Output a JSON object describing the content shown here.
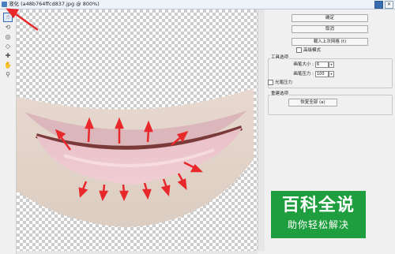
{
  "window": {
    "title": "液化 (a48b764ffcd837.jpg @ 800%)",
    "close_glyph": "✕"
  },
  "tools": [
    {
      "icon": "forward-warp-icon",
      "glyph": "☝",
      "active": true
    },
    {
      "icon": "reconstruct-icon",
      "glyph": "⟲"
    },
    {
      "icon": "twirl-icon",
      "glyph": "◎"
    },
    {
      "icon": "pucker-icon",
      "glyph": "◇"
    },
    {
      "icon": "bloat-icon",
      "glyph": "✚"
    },
    {
      "icon": "hand-icon",
      "glyph": "✋"
    },
    {
      "icon": "zoom-icon",
      "glyph": "⚲"
    }
  ],
  "panel": {
    "ok_label": "确定",
    "cancel_label": "取消",
    "load_mesh_label": "载入上次网格 (t)",
    "advanced_mode_label": "高级模式",
    "tool_options_label": "工具选项",
    "brush_size_label": "画笔大小 :",
    "brush_size_value": "6",
    "brush_pressure_label": "画笔压力 :",
    "brush_pressure_value": "100",
    "stylus_pressure_label": "光笔压力",
    "reconstruct_options_label": "重建选项",
    "restore_all_label": "恢复全部 (a)"
  },
  "watermark": {
    "main": "百科全说",
    "sub": "助你轻松解决"
  }
}
